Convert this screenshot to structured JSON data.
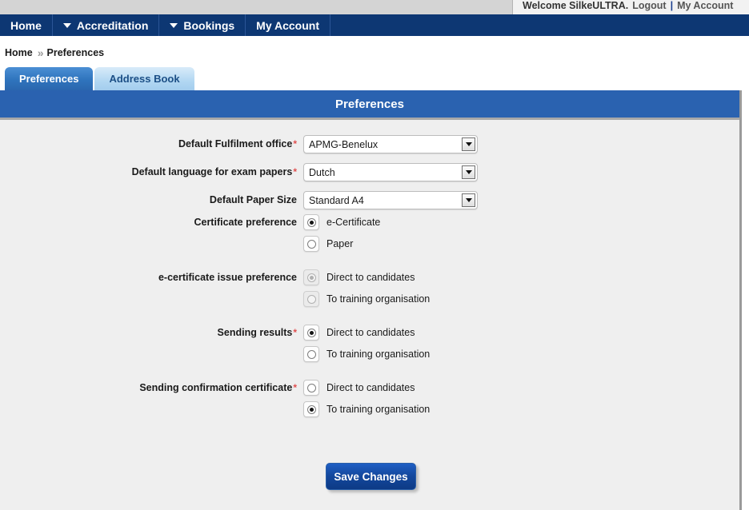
{
  "topbar": {
    "welcome_text": "Welcome SilkeULTRA.",
    "logout_label": "Logout",
    "separator": "|",
    "my_account_label": "My Account"
  },
  "nav": {
    "items": [
      {
        "label": "Home",
        "has_caret": false
      },
      {
        "label": "Accreditation",
        "has_caret": true
      },
      {
        "label": "Bookings",
        "has_caret": true
      },
      {
        "label": "My Account",
        "has_caret": false
      }
    ]
  },
  "breadcrumb": {
    "home": "Home",
    "separator": "»",
    "current": "Preferences"
  },
  "tabs": [
    {
      "label": "Preferences",
      "active": true
    },
    {
      "label": "Address Book",
      "active": false
    }
  ],
  "panel": {
    "title": "Preferences"
  },
  "form": {
    "required_marker": "*",
    "selects": [
      {
        "label": "Default Fulfilment office",
        "required": true,
        "value": "APMG-Benelux"
      },
      {
        "label": "Default language for exam papers",
        "required": true,
        "value": "Dutch"
      },
      {
        "label": "Default Paper Size",
        "required": false,
        "value": "Standard A4"
      }
    ],
    "radio_groups": [
      {
        "label": "Certificate preference",
        "required": false,
        "disabled": false,
        "options": [
          {
            "label": "e-Certificate",
            "checked": true
          },
          {
            "label": "Paper",
            "checked": false
          }
        ]
      },
      {
        "label": "e-certificate issue preference",
        "required": false,
        "disabled": true,
        "options": [
          {
            "label": "Direct to candidates",
            "checked": true
          },
          {
            "label": "To training organisation",
            "checked": false
          }
        ]
      },
      {
        "label": "Sending results",
        "required": true,
        "disabled": false,
        "options": [
          {
            "label": "Direct to candidates",
            "checked": true
          },
          {
            "label": "To training organisation",
            "checked": false
          }
        ]
      },
      {
        "label": "Sending confirmation certificate",
        "required": true,
        "disabled": false,
        "options": [
          {
            "label": "Direct to candidates",
            "checked": false
          },
          {
            "label": "To training organisation",
            "checked": true
          }
        ]
      }
    ],
    "save_label": "Save Changes"
  },
  "colors": {
    "nav_blue": "#0d3773",
    "panel_header_blue": "#2a62b0",
    "active_tab_blue": "#2f74bd",
    "inactive_tab_blue": "#b2d7f2",
    "required_red": "#e05050",
    "save_button_blue": "#14499f",
    "panel_background": "#efefef"
  }
}
